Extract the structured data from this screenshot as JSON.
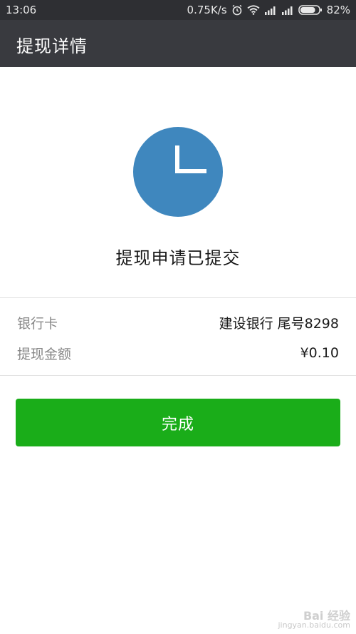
{
  "status_bar": {
    "time": "13:06",
    "network_speed": "0.75K/s",
    "battery_percent": "82%",
    "icons": [
      "alarm-icon",
      "wifi-icon",
      "signal-icon",
      "signal-icon",
      "battery-icon"
    ],
    "battery_level": 0.82
  },
  "app_bar": {
    "title": "提现详情"
  },
  "result": {
    "icon": "clock-icon",
    "icon_color": "#3f87be",
    "title": "提现申请已提交"
  },
  "details": {
    "rows": [
      {
        "label": "银行卡",
        "value": "建设银行 尾号8298"
      },
      {
        "label": "提现金额",
        "value": "¥0.10"
      }
    ]
  },
  "actions": {
    "done_label": "完成",
    "done_color": "#1aad19"
  },
  "watermark": {
    "logo": "Bai 经验",
    "url": "jingyan.baidu.com"
  }
}
